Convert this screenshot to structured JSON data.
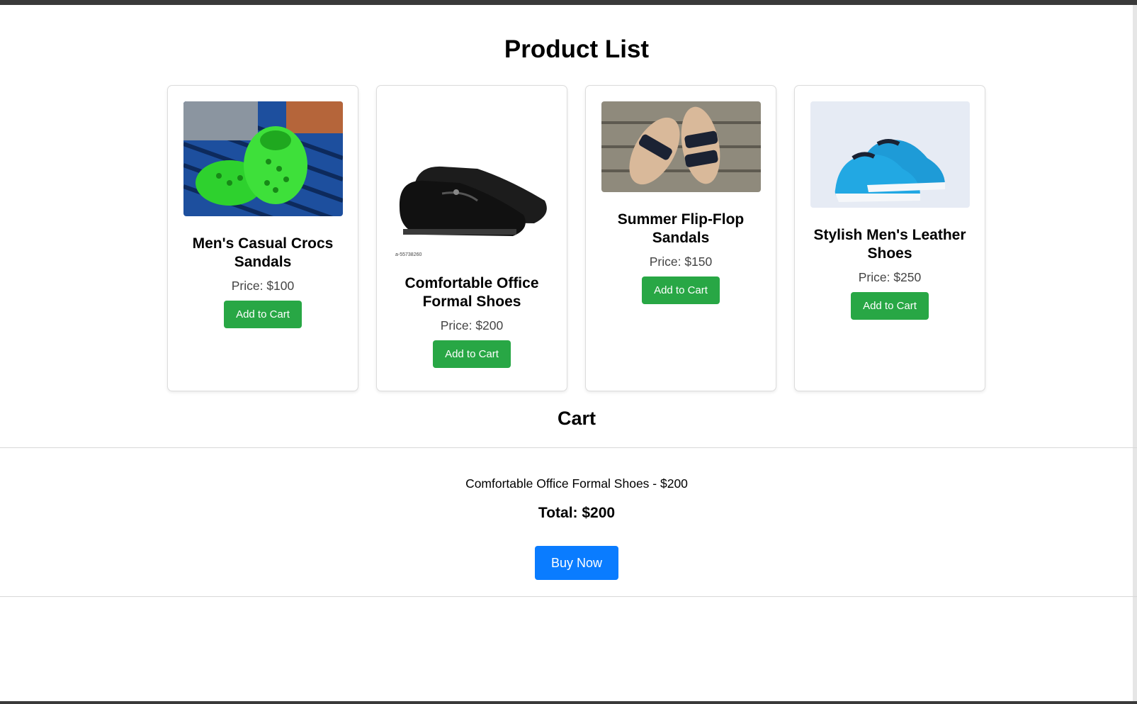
{
  "page": {
    "title": "Product List"
  },
  "products": [
    {
      "name": "Men's Casual Crocs Sandals",
      "price": "Price: $100",
      "button": "Add to Cart",
      "image": "green-crocs-image"
    },
    {
      "name": "Comfortable Office Formal Shoes",
      "price": "Price: $200",
      "button": "Add to Cart",
      "image": "black-formal-shoes-image",
      "image_caption": "a-55738260"
    },
    {
      "name": "Summer Flip-Flop Sandals",
      "price": "Price: $150",
      "button": "Add to Cart",
      "image": "sandals-on-wood-image"
    },
    {
      "name": "Stylish Men's Leather Shoes",
      "price": "Price: $250",
      "button": "Add to Cart",
      "image": "blue-sneakers-image"
    }
  ],
  "cart": {
    "title": "Cart",
    "items": [
      "Comfortable Office Formal Shoes - $200"
    ],
    "total": "Total: $200",
    "buy_label": "Buy Now"
  },
  "colors": {
    "add_button": "#28a745",
    "buy_button": "#0a7cff",
    "card_border": "#dcdcdc"
  }
}
